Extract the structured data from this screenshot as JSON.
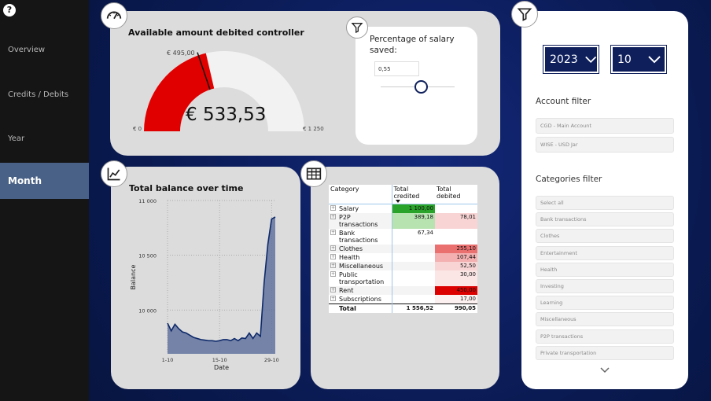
{
  "help_glyph": "?",
  "nav": {
    "items": [
      {
        "label": "Overview",
        "active": false
      },
      {
        "label": "Credits / Debits",
        "active": false
      },
      {
        "label": "Year",
        "active": false
      },
      {
        "label": "Month",
        "active": true
      }
    ]
  },
  "gauge": {
    "title": "Available amount debited controller",
    "target_label": "€ 495,00",
    "value_label": "€ 533,53",
    "min_label": "€ 0",
    "max_label": "€ 1 250",
    "value": 533.53,
    "target": 495.0,
    "min": 0,
    "max": 1250,
    "fill_color": "#e00000",
    "track_color": "#f2f2f2"
  },
  "salary": {
    "title": "Percentage of salary saved:",
    "input_value": "0,55",
    "slider_value": 0.55
  },
  "balance_chart": {
    "title": "Total balance over time"
  },
  "chart_data": {
    "type": "area",
    "title": "Total balance over time",
    "xlabel": "Date",
    "ylabel": "Balance",
    "ylim": [
      9600,
      11000
    ],
    "ytick_labels": [
      "11 000",
      "10 500",
      "10 000"
    ],
    "xtick_labels": [
      "1-10",
      "15-10",
      "29-10"
    ],
    "x": [
      1,
      2,
      3,
      4,
      5,
      6,
      7,
      8,
      9,
      10,
      11,
      12,
      13,
      14,
      15,
      16,
      17,
      18,
      19,
      20,
      21,
      22,
      23,
      24,
      25,
      26,
      27,
      28,
      29,
      30
    ],
    "values": [
      9880,
      9810,
      9870,
      9830,
      9800,
      9790,
      9770,
      9750,
      9740,
      9730,
      9725,
      9720,
      9720,
      9715,
      9720,
      9730,
      9730,
      9720,
      9740,
      9720,
      9745,
      9740,
      9790,
      9740,
      9790,
      9760,
      10250,
      10600,
      10830,
      10850
    ],
    "color": "#0e2a6b",
    "grid": true
  },
  "matrix": {
    "headers": {
      "category": "Category",
      "credited": "Total credited",
      "debited": "Total debited"
    },
    "rows": [
      {
        "category": "Salary",
        "credited": "1 100,00",
        "debited": "",
        "credited_bg": "#29a329",
        "debited_bg": ""
      },
      {
        "category": "P2P transactions",
        "credited": "389,18",
        "debited": "78,01",
        "credited_bg": "#b6e3b0",
        "debited_bg": "#f8d4d4"
      },
      {
        "category": "Bank transactions",
        "credited": "67,34",
        "debited": "",
        "credited_bg": "",
        "debited_bg": ""
      },
      {
        "category": "Clothes",
        "credited": "",
        "debited": "255,10",
        "credited_bg": "",
        "debited_bg": "#ea7070"
      },
      {
        "category": "Health",
        "credited": "",
        "debited": "107,44",
        "credited_bg": "",
        "debited_bg": "#f4b0b0"
      },
      {
        "category": "Miscellaneous",
        "credited": "",
        "debited": "52,50",
        "credited_bg": "",
        "debited_bg": "#f8d4d4"
      },
      {
        "category": "Public transportation",
        "credited": "",
        "debited": "30,00",
        "credited_bg": "",
        "debited_bg": "#fbe5e5"
      },
      {
        "category": "Rent",
        "credited": "",
        "debited": "450,00",
        "credited_bg": "",
        "debited_bg": "#dd0000"
      },
      {
        "category": "Subscriptions",
        "credited": "",
        "debited": "17,00",
        "credited_bg": "",
        "debited_bg": "#fdf0f0"
      }
    ],
    "total_label": "Total",
    "total_credited": "1 556,52",
    "total_debited": "990,05"
  },
  "filters": {
    "year": "2023",
    "month": "10",
    "account_title": "Account filter",
    "accounts": [
      "CGD - Main Account",
      "WISE - USD Jar"
    ],
    "categories_title": "Categories filter",
    "categories": [
      "Select all",
      "Bank transactions",
      "Clothes",
      "Entertainment",
      "Health",
      "Investing",
      "Learning",
      "Miscellaneous",
      "P2P transactions",
      "Private transportation"
    ]
  }
}
